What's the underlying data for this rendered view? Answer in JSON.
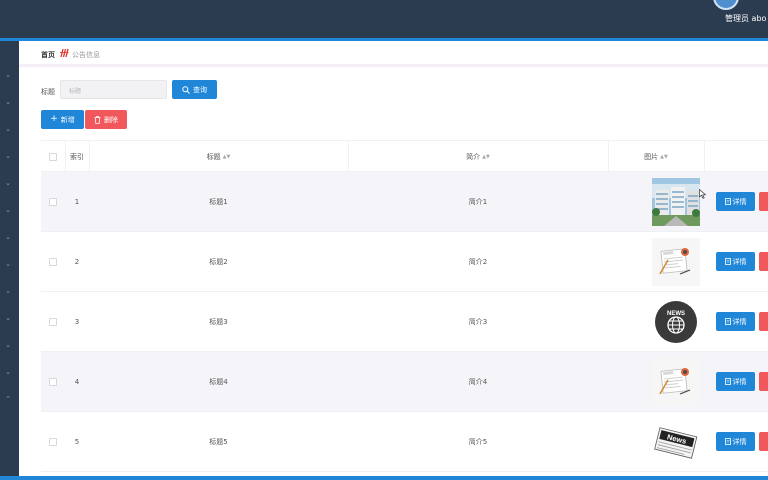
{
  "header": {
    "admin_label": "管理员 abo"
  },
  "breadcrumb": {
    "home": "首页",
    "current": "公告信息"
  },
  "search": {
    "label": "标题",
    "placeholder": "标题",
    "button": "查询"
  },
  "toolbar": {
    "add": "新增",
    "delete": "删除"
  },
  "table": {
    "headers": {
      "index": "索引",
      "title": "标题",
      "intro": "简介",
      "image": "图片"
    },
    "rows": [
      {
        "index": "1",
        "title": "标题1",
        "intro": "简介1",
        "image": "building-photo",
        "detail": "详情"
      },
      {
        "index": "2",
        "title": "标题2",
        "intro": "简介2",
        "image": "newspaper-illustration",
        "detail": "详情"
      },
      {
        "index": "3",
        "title": "标题3",
        "intro": "简介3",
        "image": "news-globe-icon",
        "detail": "详情"
      },
      {
        "index": "4",
        "title": "标题4",
        "intro": "简介4",
        "image": "newspaper-illustration",
        "detail": "详情"
      },
      {
        "index": "5",
        "title": "标题5",
        "intro": "简介5",
        "image": "news-paper-icon",
        "detail": "详情"
      }
    ]
  },
  "colors": {
    "primary": "#1f86d8",
    "danger": "#f0585c",
    "sidebar": "#2b3b50"
  }
}
